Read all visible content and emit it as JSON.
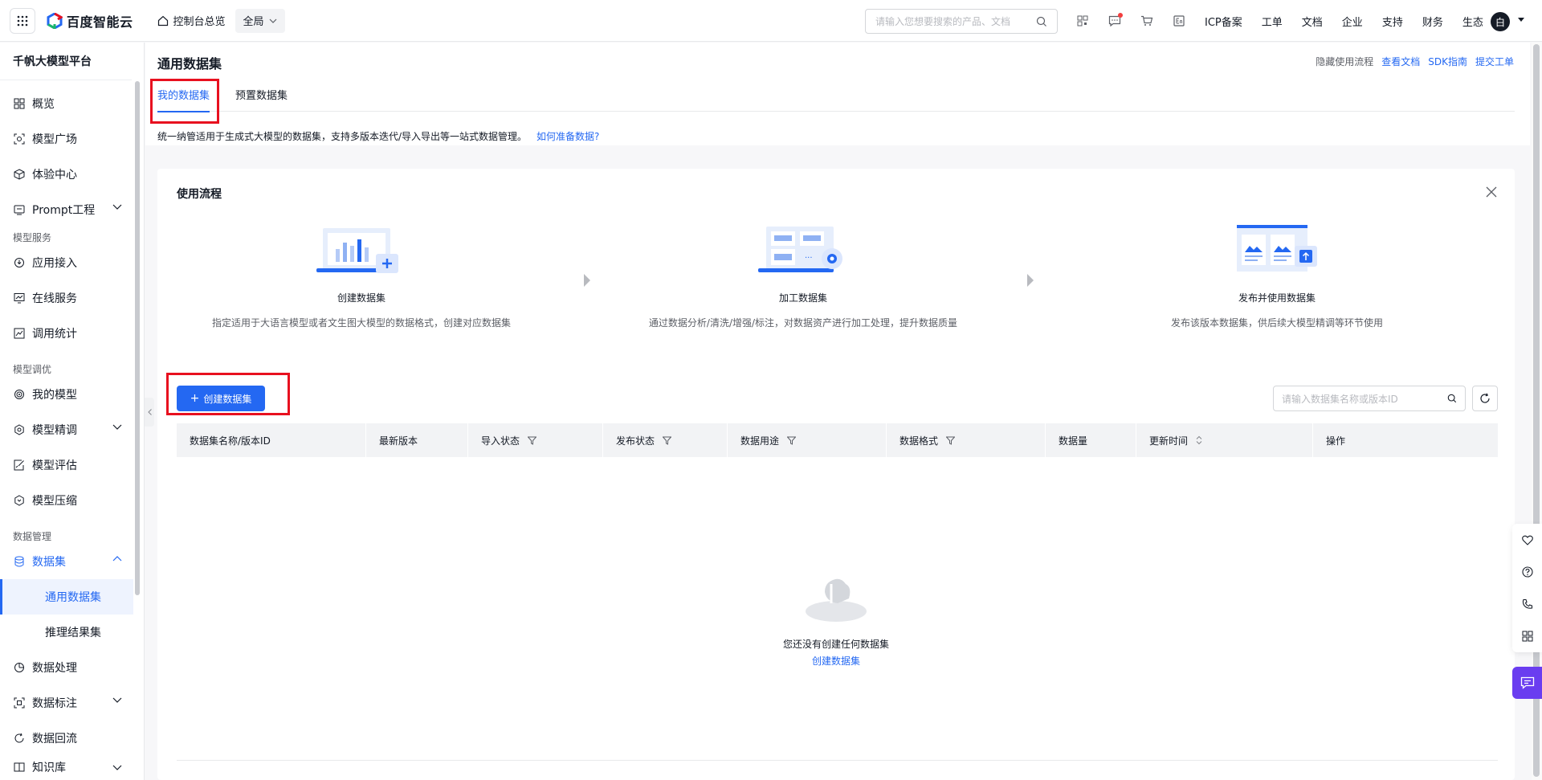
{
  "header": {
    "logo_text": "百度智能云",
    "console_home": "控制台总览",
    "region": "全局",
    "search_placeholder": "请输入您想要搜索的产品、文档",
    "nav": [
      "ICP备案",
      "工单",
      "文档",
      "企业",
      "支持",
      "财务",
      "生态"
    ],
    "avatar_initial": "白"
  },
  "sidebar": {
    "title": "千帆大模型平台",
    "items": {
      "overview": "概览",
      "model_square": "模型广场",
      "experience": "体验中心",
      "prompt": "Prompt工程",
      "group_service": "模型服务",
      "app_access": "应用接入",
      "online_service": "在线服务",
      "usage_stats": "调用统计",
      "group_tuning": "模型调优",
      "my_models": "我的模型",
      "finetune": "模型精调",
      "evaluate": "模型评估",
      "compress": "模型压缩",
      "group_data": "数据管理",
      "datasets": "数据集",
      "general_datasets": "通用数据集",
      "inference_results": "推理结果集",
      "data_processing": "数据处理",
      "data_labeling": "数据标注",
      "data_reflow": "数据回流",
      "knowledge_base": "知识库"
    }
  },
  "page": {
    "title": "通用数据集",
    "links": {
      "hide_flow": "隐藏使用流程",
      "docs": "查看文档",
      "sdk": "SDK指南",
      "ticket": "提交工单"
    },
    "tabs": [
      "我的数据集",
      "预置数据集"
    ],
    "description": "统一纳管适用于生成式大模型的数据集，支持多版本迭代/导入导出等一站式数据管理。",
    "description_link": "如何准备数据?"
  },
  "flow": {
    "title": "使用流程",
    "steps": [
      {
        "name": "创建数据集",
        "desc": "指定适用于大语言模型或者文生图大模型的数据格式，创建对应数据集"
      },
      {
        "name": "加工数据集",
        "desc": "通过数据分析/清洗/增强/标注，对数据资产进行加工处理，提升数据质量"
      },
      {
        "name": "发布并使用数据集",
        "desc": "发布该版本数据集，供后续大模型精调等环节使用"
      }
    ]
  },
  "table": {
    "create_button": "创建数据集",
    "search_placeholder": "请输入数据集名称或版本ID",
    "columns": [
      "数据集名称/版本ID",
      "最新版本",
      "导入状态",
      "发布状态",
      "数据用途",
      "数据格式",
      "数据量",
      "更新时间",
      "操作"
    ],
    "empty_text": "您还没有创建任何数据集",
    "empty_link": "创建数据集"
  },
  "colors": {
    "primary": "#2468f2",
    "highlight": "#e8101f",
    "chat": "#6a3df0"
  }
}
